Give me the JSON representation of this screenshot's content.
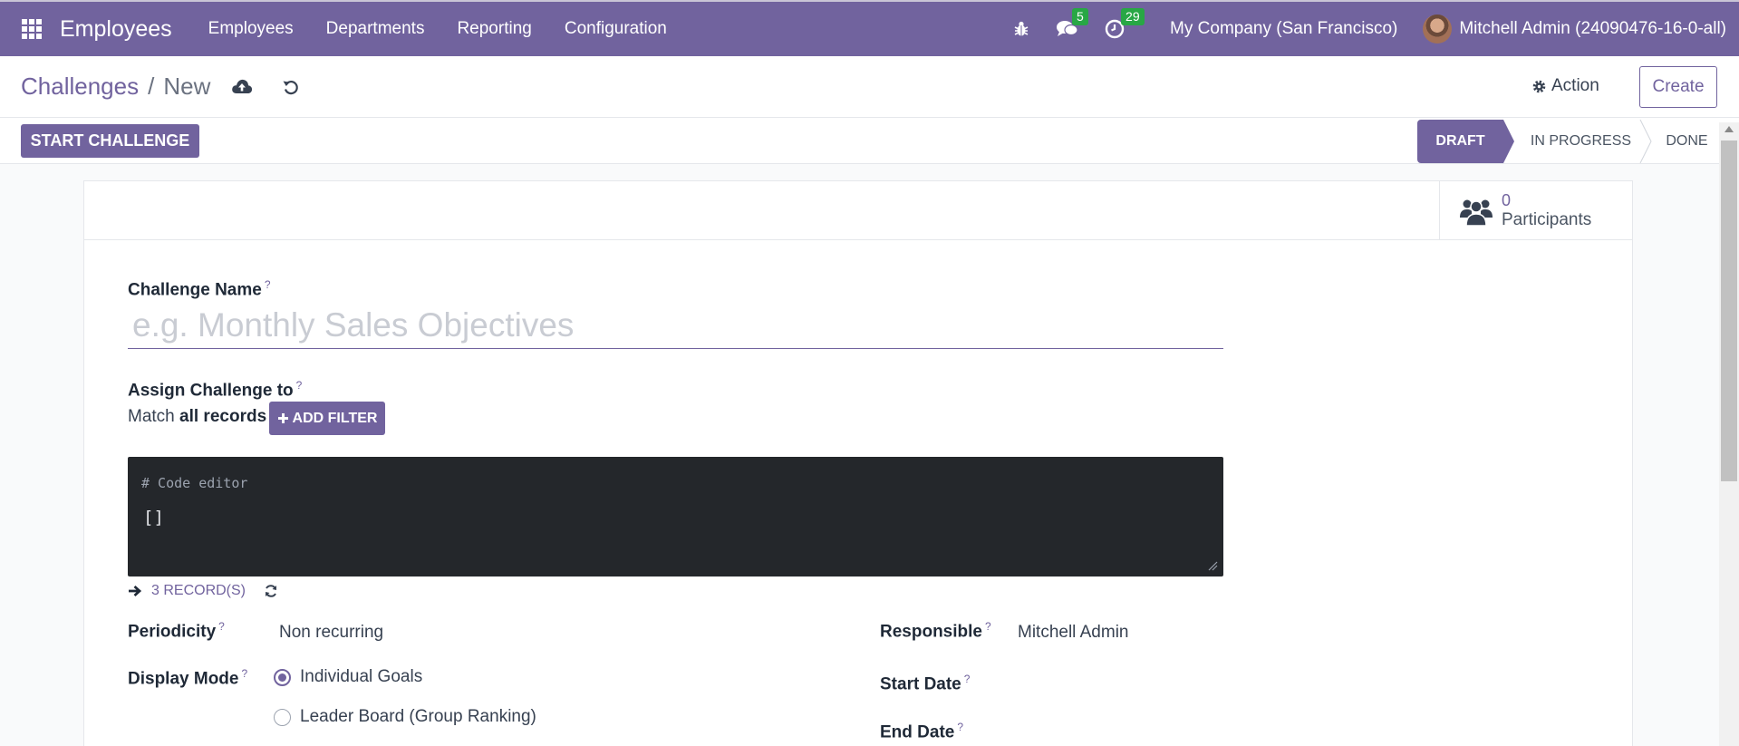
{
  "navbar": {
    "app_title": "Employees",
    "menu": [
      "Employees",
      "Departments",
      "Reporting",
      "Configuration"
    ],
    "messages_count": "5",
    "activities_count": "29",
    "company": "My Company (San Francisco)",
    "user": "Mitchell Admin (24090476-16-0-all)"
  },
  "control": {
    "breadcrumb_parent": "Challenges",
    "breadcrumb_separator": "/",
    "breadcrumb_current": "New",
    "action_label": "Action",
    "create_label": "Create"
  },
  "statusbar": {
    "start_label": "START CHALLENGE",
    "stages": [
      "DRAFT",
      "IN PROGRESS",
      "DONE"
    ],
    "active_stage": "DRAFT"
  },
  "form": {
    "participants_count": "0",
    "participants_label": "Participants",
    "challenge_name_label": "Challenge Name",
    "challenge_name_placeholder": "e.g. Monthly Sales Objectives",
    "challenge_name_value": "",
    "help_mark": "?",
    "assign_label": "Assign Challenge to",
    "match_prefix": "Match",
    "match_bold": "all records",
    "add_filter_label": "ADD FILTER",
    "code_comment": "# Code editor",
    "code_value": "[]",
    "records_label": "3 RECORD(S)",
    "periodicity_label": "Periodicity",
    "periodicity_value": "Non recurring",
    "display_mode_label": "Display Mode",
    "display_options": [
      "Individual Goals",
      "Leader Board (Group Ranking)"
    ],
    "display_selected": "Individual Goals",
    "responsible_label": "Responsible",
    "responsible_value": "Mitchell Admin",
    "start_date_label": "Start Date",
    "end_date_label": "End Date"
  },
  "colors": {
    "brand": "#71639e",
    "badge_green": "#28a745",
    "code_bg": "#24272b"
  }
}
